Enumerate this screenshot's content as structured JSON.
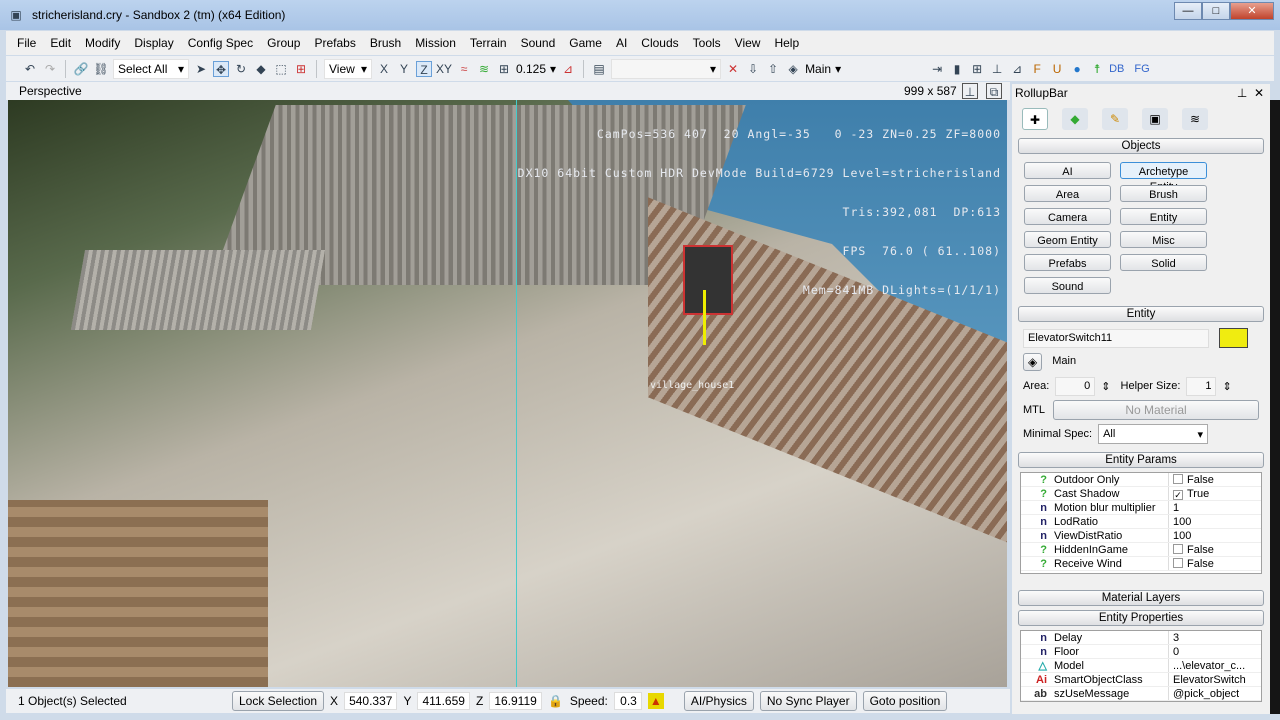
{
  "window": {
    "title": "stricherisland.cry - Sandbox 2 (tm) (x64 Edition)",
    "minimize": "—",
    "maximize": "□",
    "close": "✕"
  },
  "menu": [
    "File",
    "Edit",
    "Modify",
    "Display",
    "Config Spec",
    "Group",
    "Prefabs",
    "Brush",
    "Mission",
    "Terrain",
    "Sound",
    "Game",
    "AI",
    "Clouds",
    "Tools",
    "View",
    "Help"
  ],
  "toolbar": {
    "selection": "Select All",
    "view": "View",
    "axes": [
      "X",
      "Y",
      "Z",
      "XY"
    ],
    "grid": "0.125",
    "layer": "Main",
    "db": "DB",
    "fg": "FG"
  },
  "viewport": {
    "name": "Perspective",
    "resolution": "999 x 587",
    "hud": [
      "CamPos=536 407  20 Angl=-35   0 -23 ZN=0.25 ZF=8000",
      "DX10 64bit Custom HDR DevMode Build=6729 Level=stricherisland",
      "Tris:392,081  DP:613",
      "FPS  76.0 ( 61..108)",
      "Mem=841MB DLights=(1/1/1)"
    ],
    "object_label": "village_house1"
  },
  "status": {
    "selected": "1 Object(s) Selected",
    "lock": "Lock Selection",
    "x_label": "X",
    "x": "540.337",
    "y_label": "Y",
    "y": "411.659",
    "z_label": "Z",
    "z": "16.9119",
    "speed_label": "Speed:",
    "speed": "0.3",
    "ai_physics": "AI/Physics",
    "sync": "No Sync Player",
    "goto": "Goto position"
  },
  "rollup": {
    "title": "RollupBar",
    "objects_header": "Objects",
    "objects": [
      "AI",
      "Archetype Entity",
      "Area",
      "Brush",
      "Camera",
      "Entity",
      "Geom Entity",
      "Misc",
      "Prefabs",
      "Solid",
      "Sound"
    ],
    "entity_header": "Entity",
    "entity_name": "ElevatorSwitch11",
    "entity_color": "#f0ec10",
    "layer": "Main",
    "area_label": "Area:",
    "area": "0",
    "helper_label": "Helper Size:",
    "helper": "1",
    "mtl_label": "MTL",
    "mtl": "No Material",
    "spec_label": "Minimal Spec:",
    "spec": "All",
    "params_header": "Entity Params",
    "params": [
      {
        "i": "?",
        "n": "Outdoor Only",
        "v": "False",
        "cb": "off"
      },
      {
        "i": "?",
        "n": "Cast Shadow",
        "v": "True",
        "cb": "on"
      },
      {
        "i": "n",
        "n": "Motion blur multiplier",
        "v": "1"
      },
      {
        "i": "n",
        "n": "LodRatio",
        "v": "100"
      },
      {
        "i": "n",
        "n": "ViewDistRatio",
        "v": "100"
      },
      {
        "i": "?",
        "n": "HiddenInGame",
        "v": "False",
        "cb": "off"
      },
      {
        "i": "?",
        "n": "Receive Wind",
        "v": "False",
        "cb": "off"
      }
    ],
    "material_layers": "Material Layers",
    "props_header": "Entity Properties",
    "props": [
      {
        "i": "n",
        "n": "Delay",
        "v": "3"
      },
      {
        "i": "n",
        "n": "Floor",
        "v": "0"
      },
      {
        "i": "△",
        "n": "Model",
        "v": "...\\elevator_c..."
      },
      {
        "i": "Ai",
        "n": "SmartObjectClass",
        "v": "ElevatorSwitch"
      },
      {
        "i": "ab",
        "n": "szUseMessage",
        "v": "@pick_object"
      }
    ]
  }
}
